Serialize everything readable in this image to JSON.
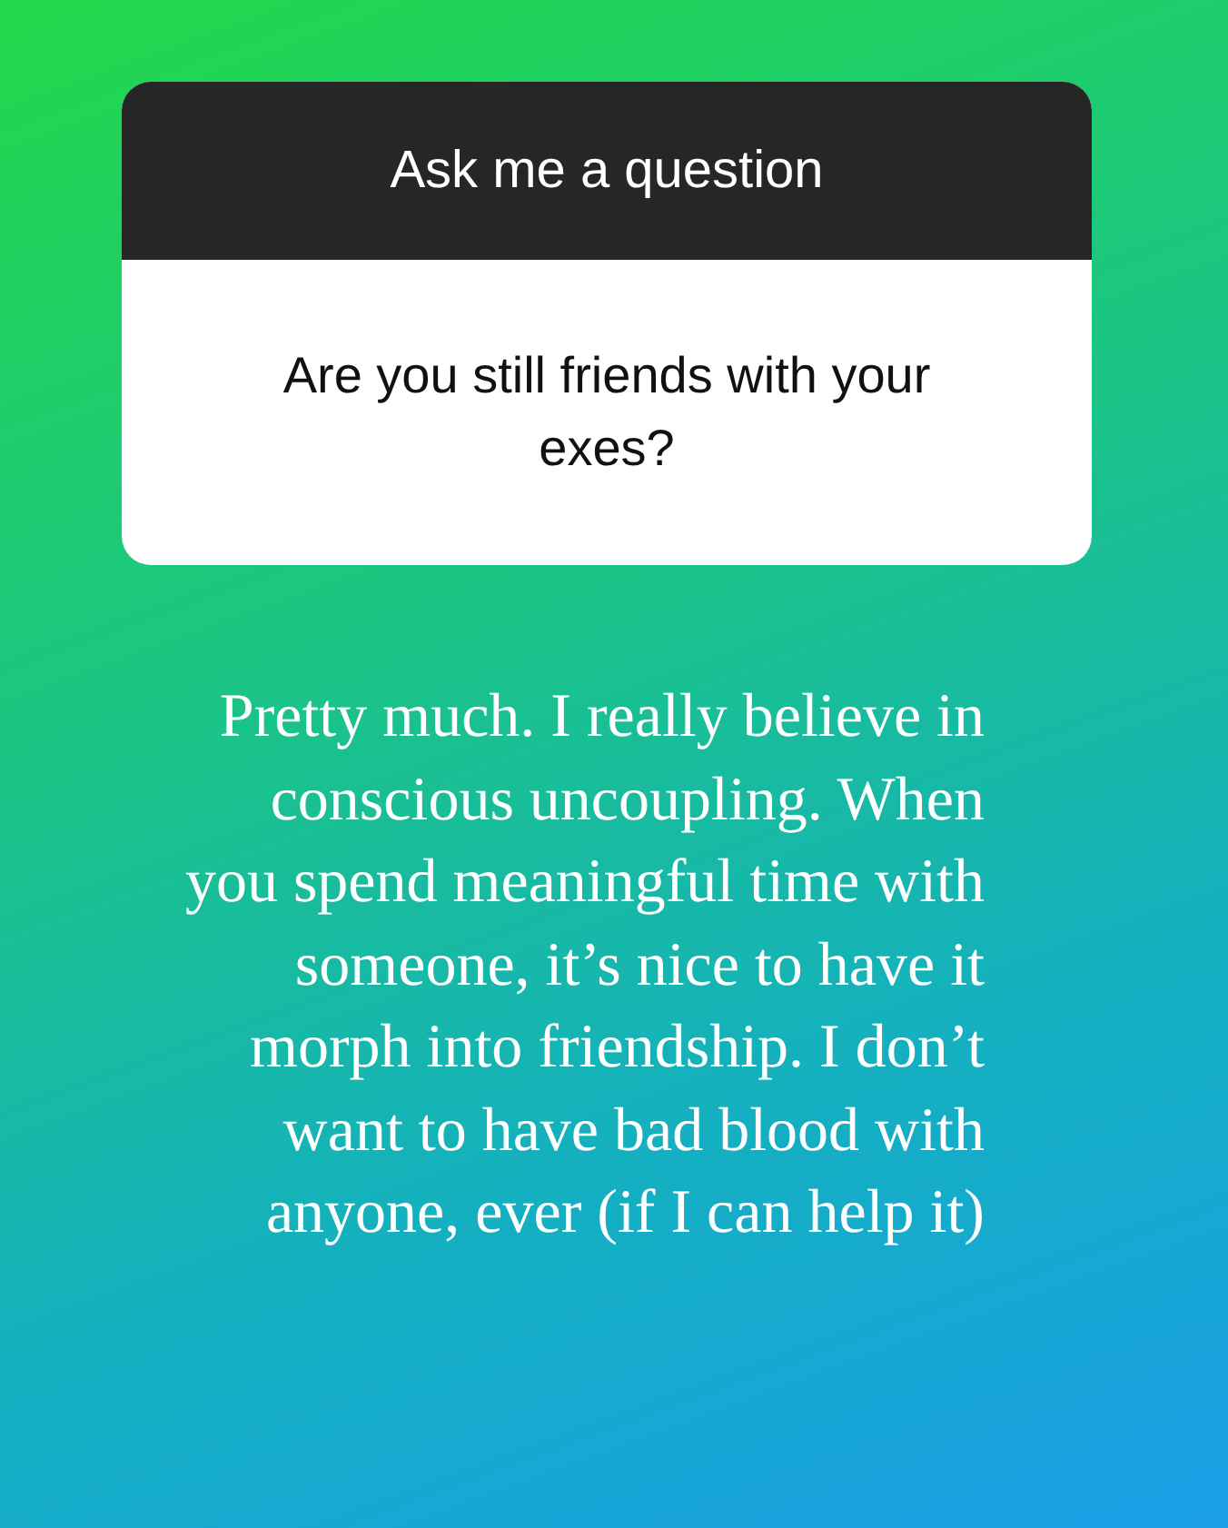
{
  "question_card": {
    "title": "Ask me a question",
    "question": "Are you still friends with your exes?"
  },
  "answer": "Pretty much. I really believe in conscious uncoupling. When you spend meaningful time with someone, it’s nice to have it morph into friendship. I don’t want to have bad blood with anyone, ever (if I can help it)"
}
